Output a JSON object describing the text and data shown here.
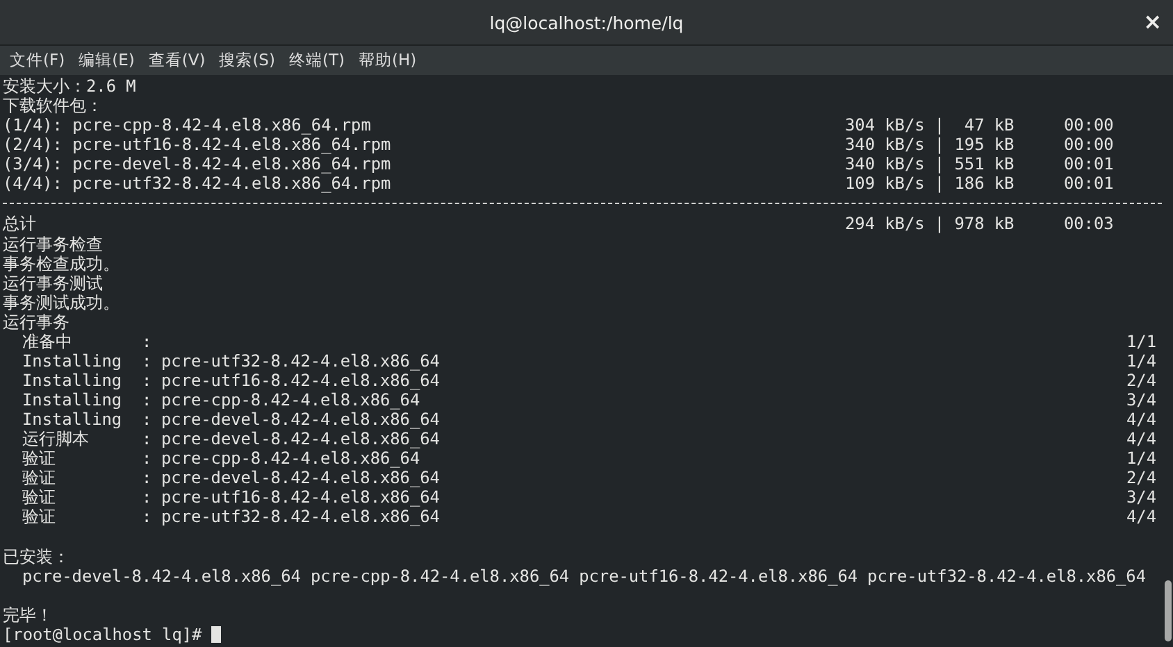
{
  "window": {
    "title": "lq@localhost:/home/lq",
    "close": "×"
  },
  "menu": [
    {
      "label": "文件(F)"
    },
    {
      "label": "编辑(E)"
    },
    {
      "label": "查看(V)"
    },
    {
      "label": "搜索(S)"
    },
    {
      "label": "终端(T)"
    },
    {
      "label": "帮助(H)"
    }
  ],
  "terminal": {
    "lines": [
      {
        "kind": "text",
        "text": "安装大小：2.6 M"
      },
      {
        "kind": "text",
        "text": "下载软件包："
      },
      {
        "kind": "download",
        "name": "(1/4): pcre-cpp-8.42-4.el8.x86_64.rpm",
        "stats": "304 kB/s |  47 kB     00:00"
      },
      {
        "kind": "download",
        "name": "(2/4): pcre-utf16-8.42-4.el8.x86_64.rpm",
        "stats": "340 kB/s | 195 kB     00:00"
      },
      {
        "kind": "download",
        "name": "(3/4): pcre-devel-8.42-4.el8.x86_64.rpm",
        "stats": "340 kB/s | 551 kB     00:01"
      },
      {
        "kind": "download",
        "name": "(4/4): pcre-utf32-8.42-4.el8.x86_64.rpm",
        "stats": "109 kB/s | 186 kB     00:01"
      },
      {
        "kind": "separator"
      },
      {
        "kind": "download",
        "name": "总计",
        "stats": "294 kB/s | 978 kB     00:03"
      },
      {
        "kind": "text",
        "text": "运行事务检查"
      },
      {
        "kind": "text",
        "text": "事务检查成功。"
      },
      {
        "kind": "text",
        "text": "运行事务测试"
      },
      {
        "kind": "text",
        "text": "事务测试成功。"
      },
      {
        "kind": "text",
        "text": "运行事务"
      },
      {
        "kind": "step",
        "label": "准备中",
        "sep": ":",
        "progress": "1/1"
      },
      {
        "kind": "step",
        "label": "Installing",
        "sep": ":",
        "package": "pcre-utf32-8.42-4.el8.x86_64",
        "progress": "1/4"
      },
      {
        "kind": "step",
        "label": "Installing",
        "sep": ":",
        "package": "pcre-utf16-8.42-4.el8.x86_64",
        "progress": "2/4"
      },
      {
        "kind": "step",
        "label": "Installing",
        "sep": ":",
        "package": "pcre-cpp-8.42-4.el8.x86_64",
        "progress": "3/4"
      },
      {
        "kind": "step",
        "label": "Installing",
        "sep": ":",
        "package": "pcre-devel-8.42-4.el8.x86_64",
        "progress": "4/4"
      },
      {
        "kind": "step",
        "label": "运行脚本",
        "sep": ":",
        "package": "pcre-devel-8.42-4.el8.x86_64",
        "progress": "4/4"
      },
      {
        "kind": "step",
        "label": "验证",
        "sep": ":",
        "package": "pcre-cpp-8.42-4.el8.x86_64",
        "progress": "1/4"
      },
      {
        "kind": "step",
        "label": "验证",
        "sep": ":",
        "package": "pcre-devel-8.42-4.el8.x86_64",
        "progress": "2/4"
      },
      {
        "kind": "step",
        "label": "验证",
        "sep": ":",
        "package": "pcre-utf16-8.42-4.el8.x86_64",
        "progress": "3/4"
      },
      {
        "kind": "step",
        "label": "验证",
        "sep": ":",
        "package": "pcre-utf32-8.42-4.el8.x86_64",
        "progress": "4/4"
      },
      {
        "kind": "blank"
      },
      {
        "kind": "text",
        "text": "已安装："
      },
      {
        "kind": "packages",
        "items": [
          "pcre-devel-8.42-4.el8.x86_64",
          "pcre-cpp-8.42-4.el8.x86_64",
          "pcre-utf16-8.42-4.el8.x86_64",
          "pcre-utf32-8.42-4.el8.x86_64"
        ]
      },
      {
        "kind": "blank"
      },
      {
        "kind": "text",
        "text": "完毕！"
      },
      {
        "kind": "prompt",
        "text": "[root@localhost lq]#"
      }
    ]
  }
}
